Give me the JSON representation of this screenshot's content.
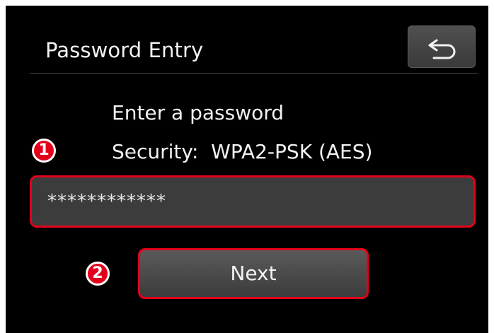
{
  "header": {
    "title": "Password Entry",
    "back_icon": "back-arrow-icon"
  },
  "form": {
    "prompt": "Enter a password",
    "security": "Security:  WPA2-PSK (AES)",
    "password_value": "************",
    "next_label": "Next"
  },
  "callouts": {
    "one": "1",
    "two": "2"
  },
  "colors": {
    "screen_bg": "#000000",
    "highlight": "#e3001b",
    "button_bg": "#4a4a4a",
    "text": "#f2f2f2"
  }
}
